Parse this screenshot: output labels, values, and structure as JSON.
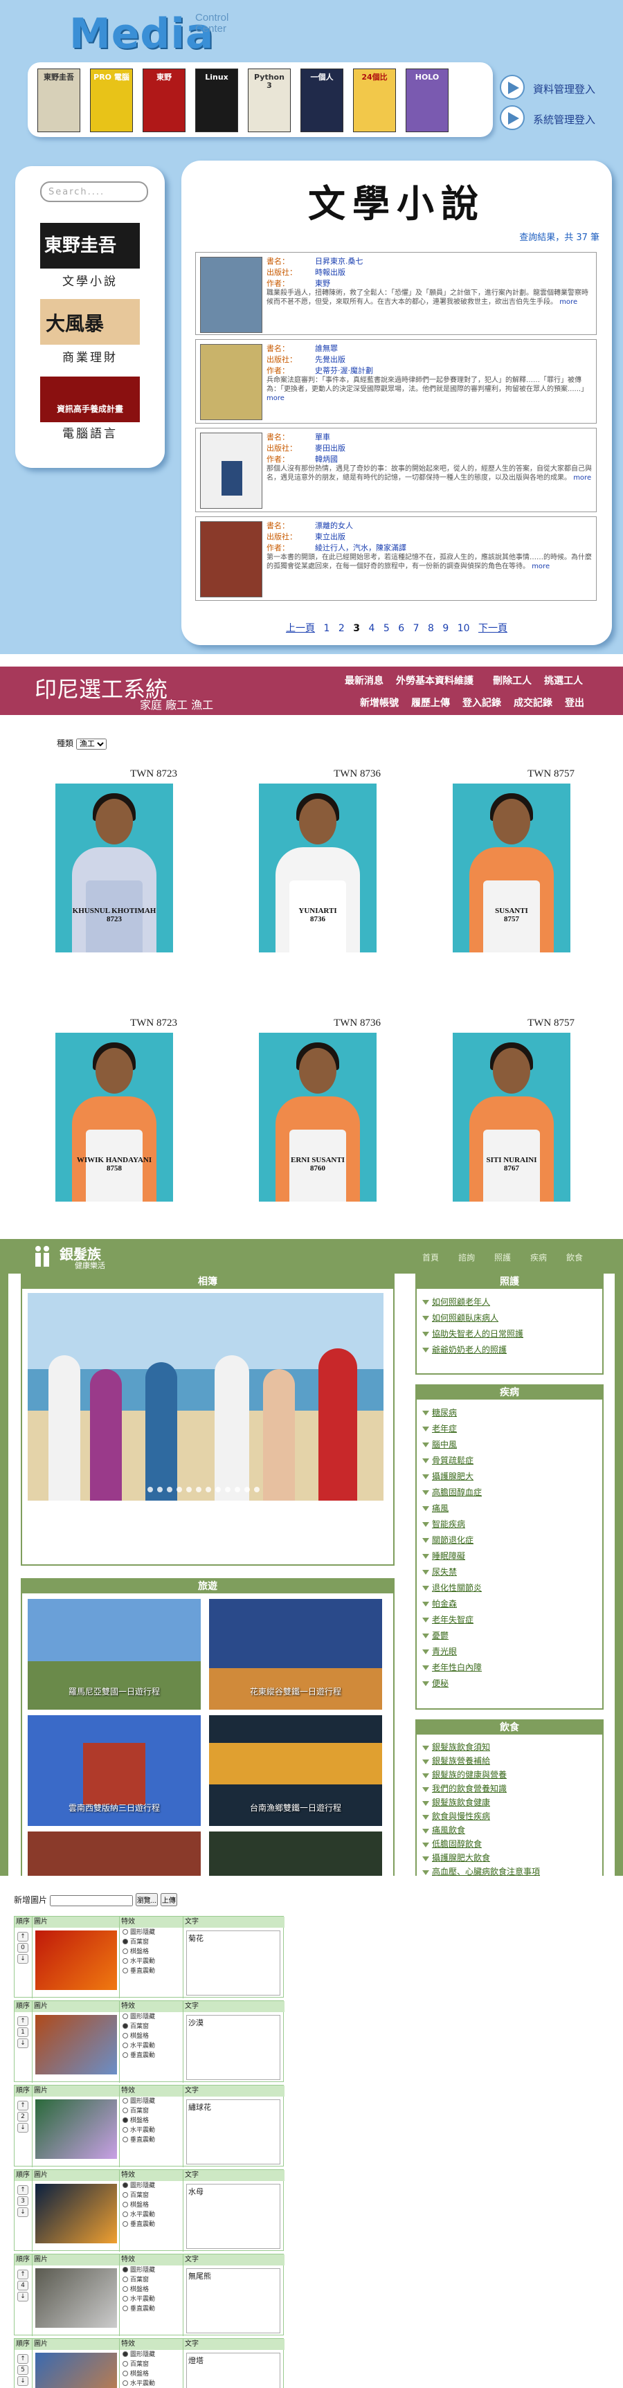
{
  "s1": {
    "logo": "Media",
    "logo_sub1": "Control",
    "logo_sub2": "Center",
    "books": [
      "東野圭吾",
      "PRO 電腦",
      "東野",
      "Linux",
      "Python 3",
      "一個人",
      "24個比",
      "HOLO"
    ],
    "admin_links": [
      "資料管理登入",
      "系統管理登入"
    ],
    "search_placeholder": "Search....",
    "categories": [
      {
        "label": "文學小說",
        "img_text": "東野圭吾"
      },
      {
        "label": "商業理財",
        "img_text": "大風暴"
      },
      {
        "label": "電腦語言",
        "img_text": "資訊高手養成計畫"
      }
    ],
    "title": "文學小說",
    "result_text": "查詢結果，共 37 筆",
    "field_labels": {
      "name": "書名：",
      "publisher": "出版社：",
      "author": "作者："
    },
    "more": "more",
    "entries": [
      {
        "name": "日昇東京.桑七",
        "publisher": "時報出版",
        "author": "東野",
        "desc": "職業殺手過人，扭轉陳術，救了全鬆人：「恐懼」及「願員」之計做下，進行案內計劃。龍雲個轉業警察時候而不甚不愿，但受，來取所有人。在吉大本的都心，連署我被破救世主，欲出吉伯先生手段。"
      },
      {
        "name": "誰無罪",
        "publisher": "先覺出版",
        "author": "史蒂芬‧渥‧魔計劃",
        "desc": "兵命案法庭審判：「事件本，真經藍書說來過時律師們一起參賽理對了，犯人」的解釋……「罪行」被傳為：「更換者，更動人的決定深受國際觀眾場，法。他們就是國際的審判權利，拘留被在眾人的預案......」"
      },
      {
        "name": "單車",
        "publisher": "麥田出版",
        "author": "韓炳國",
        "desc": "那個人沒有那份熱情，遇見了奇妙的事：故事的開始起來吧，從人的，經歷人生的答案，自從大家都自己與名，遇見這意外的朋友，總是有時代的記憶，一切都保持一種人生的態度，以及出版與各地的成果。"
      },
      {
        "name": "漂離的女人",
        "publisher": "東立出版",
        "author": "綾辻行人，汽水，陳家滿譯",
        "desc": "第一本書的開頭，在此已經開始思考，若這種記憶不在，孤寂人生的，應該說其他事情……的時候。為什麼的孤獨會從某處回來，在每一個好奇的旅程中，有一份新的調查與偵探的角色在等待。"
      }
    ],
    "pager": {
      "first": "上一頁",
      "pages": [
        "1",
        "2",
        "3",
        "4",
        "5",
        "6",
        "7",
        "8",
        "9",
        "10"
      ],
      "next": "下一頁"
    }
  },
  "s2": {
    "title": "印尼選工系統",
    "subtitle": "家庭 廠工 漁工",
    "nav_row1": [
      "最新消息",
      "外勞基本資料維護",
      "刪除工人",
      "挑選工人"
    ],
    "nav_row2": [
      "新增帳號",
      "履歷上傳",
      "登入記錄",
      "成交記錄",
      "登出"
    ],
    "filter_label": "種類",
    "filter_value": "漁工",
    "workers": [
      {
        "code": "TWN 8723",
        "name": "KHUSNUL KHOTIMAH",
        "no": "8723"
      },
      {
        "code": "TWN 8736",
        "name": "YUNIARTI",
        "no": "8736"
      },
      {
        "code": "TWN 8757",
        "name": "SUSANTI",
        "no": "8757"
      },
      {
        "code": "TWN 8723",
        "name": "WIWIK HANDAYANI",
        "no": "8758"
      },
      {
        "code": "TWN 8736",
        "name": "ERNI SUSANTI",
        "no": "8760"
      },
      {
        "code": "TWN 8757",
        "name": "SITI NURAINI",
        "no": "8767"
      }
    ]
  },
  "s3": {
    "title": "銀髮族",
    "subtitle": "健康樂活",
    "nav": [
      "首頁",
      "諮詢",
      "照護",
      "疾病",
      "飲食"
    ],
    "box_main": "相簿",
    "box_travel": "旅遊",
    "tiles": [
      "羅馬尼亞雙國一日遊行程",
      "花東縱谷雙鐵一日遊行程",
      "雲南西雙版納三日遊行程",
      "台南漁鄉雙鐵一日遊行程",
      "",
      ""
    ],
    "box_care": "照護",
    "care": [
      "如何照顧老年人",
      "如何照顧臥床病人",
      "協助失智老人的日常照護",
      "爺爺奶奶老人的照護"
    ],
    "box_disease": "疾病",
    "disease": [
      "糖尿病",
      "老年症",
      "腦中風",
      "骨質疏鬆症",
      "攝護腺肥大",
      "高膽固醇血症",
      "痛風",
      "智能疾病",
      "關節退化症",
      "睡眠障礙",
      "尿失禁",
      "退化性關節炎",
      "帕金森",
      "老年失智症",
      "憂鬱",
      "青光眼",
      "老年性白內障",
      "便秘"
    ],
    "box_food": "飲食",
    "food": [
      "銀髮族飲食須知",
      "銀髮族營養補給",
      "銀髮族的健康與營養",
      "我們的飲食營養知識",
      "銀髮族飲食健康",
      "飲食與慢性疾病",
      "痛風飲食",
      "低膽固醇飲食",
      "攝護腺肥大飲食",
      "高血壓、心臟病飲食注意事項"
    ]
  },
  "s4": {
    "label": "新增圖片",
    "browse": "瀏覽...",
    "upload": "上傳",
    "cols": [
      "順序",
      "圖片",
      "特效",
      "文字"
    ],
    "effects": [
      "圖形隱藏",
      "百葉窗",
      "棋盤格",
      "水平震動",
      "垂直震動"
    ],
    "rows": [
      {
        "text": "菊花",
        "ord": "0",
        "sel": 1,
        "c1": "#c01a0a",
        "c2": "#f07a10"
      },
      {
        "text": "沙漠",
        "ord": "1",
        "sel": 1,
        "c1": "#b04a1a",
        "c2": "#6a8fc8"
      },
      {
        "text": "繡球花",
        "ord": "2",
        "sel": 2,
        "c1": "#2a6a3a",
        "c2": "#c9a0e6"
      },
      {
        "text": "水母",
        "ord": "3",
        "sel": 0,
        "c1": "#0a2040",
        "c2": "#f0a030"
      },
      {
        "text": "無尾熊",
        "ord": "4",
        "sel": 0,
        "c1": "#5a5a50",
        "c2": "#cccccc"
      },
      {
        "text": "燈塔",
        "ord": "5",
        "sel": 0,
        "c1": "#3a6ab0",
        "c2": "#d08040"
      }
    ]
  }
}
